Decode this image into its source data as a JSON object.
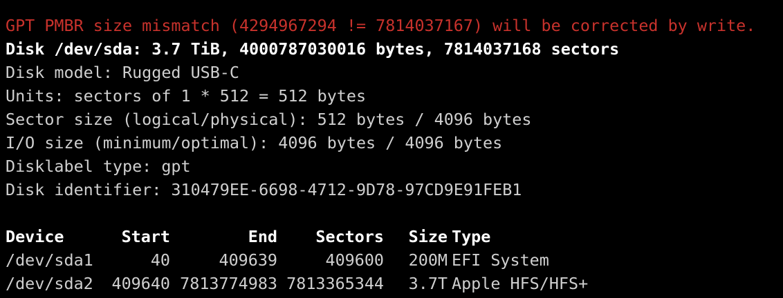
{
  "colors": {
    "background": "#000000",
    "text": "#cfcfcf",
    "warning": "#c8322c",
    "bold": "#ffffff"
  },
  "lines": {
    "warning": "GPT PMBR size mismatch (4294967294 != 7814037167) will be corrected by write.",
    "disk": "Disk /dev/sda: 3.7 TiB, 4000787030016 bytes, 7814037168 sectors",
    "model": "Disk model: Rugged USB-C",
    "units": "Units: sectors of 1 * 512 = 512 bytes",
    "sector_size": "Sector size (logical/physical): 512 bytes / 4096 bytes",
    "io_size": "I/O size (minimum/optimal): 4096 bytes / 4096 bytes",
    "label_type": "Disklabel type: gpt",
    "identifier": "Disk identifier: 310479EE-6698-4712-9D78-97CD9E91FEB1"
  },
  "table": {
    "headers": [
      "Device",
      "Start",
      "End",
      "Sectors",
      "Size",
      "Type"
    ],
    "rows": [
      [
        "/dev/sda1",
        "40",
        "409639",
        "409600",
        "200M",
        "EFI System"
      ],
      [
        "/dev/sda2",
        "409640",
        "7813774983",
        "7813365344",
        "3.7T",
        "Apple HFS/HFS+"
      ]
    ]
  }
}
